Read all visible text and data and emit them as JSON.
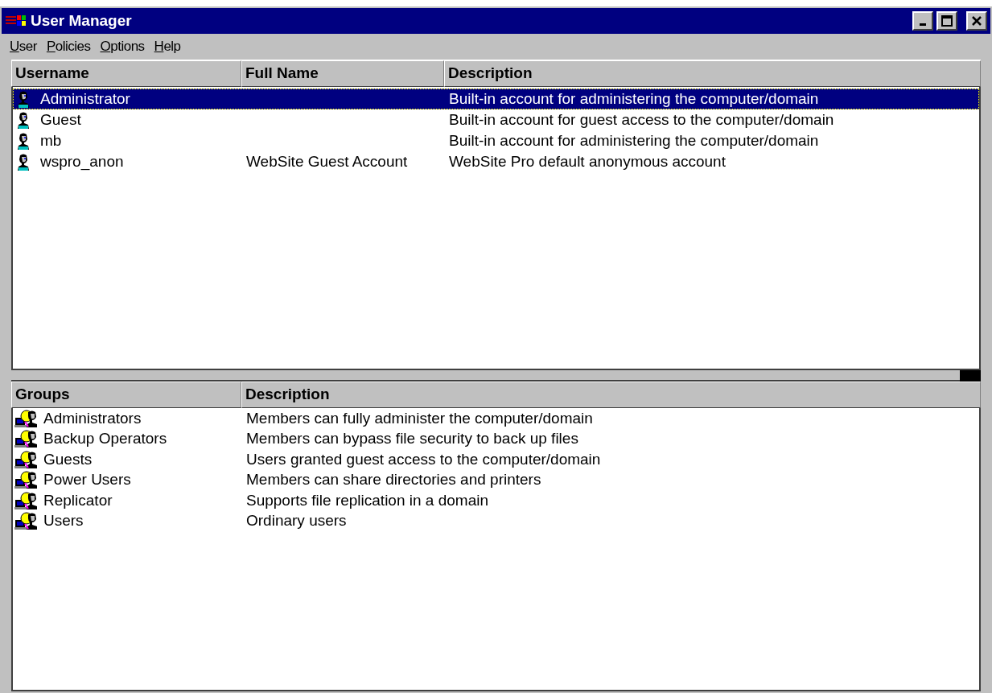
{
  "window": {
    "title": "User Manager"
  },
  "menu": [
    {
      "label": "User"
    },
    {
      "label": "Policies"
    },
    {
      "label": "Options"
    },
    {
      "label": "Help"
    }
  ],
  "users": {
    "columns": [
      "Username",
      "Full Name",
      "Description"
    ],
    "rows": [
      {
        "username": "Administrator",
        "description": "Built-in account for administering the computer/domain",
        "selected": true
      },
      {
        "username": "Guest",
        "description": "Built-in account for guest access to the computer/domain",
        "selected": false
      },
      {
        "username": "mb",
        "description": "Built-in account for administering the computer/domain",
        "selected": false
      },
      {
        "username": "wspro_anon",
        "full_name": "WebSite Guest Account",
        "description": "WebSite Pro default anonymous account",
        "selected": false
      }
    ]
  },
  "groups": {
    "columns": [
      "Groups",
      "Description"
    ],
    "rows": [
      {
        "name": "Administrators",
        "description": "Members can fully administer the computer/domain",
        "selected": false
      },
      {
        "name": "Backup Operators",
        "description": "Members can bypass file security to back up files",
        "selected": false
      },
      {
        "name": "Guests",
        "description": "Users granted guest access to the computer/domain",
        "selected": false
      },
      {
        "name": "Power Users",
        "description": "Members can share directories and printers",
        "selected": false
      },
      {
        "name": "Replicator",
        "description": "Supports file replication in a domain",
        "selected": false
      },
      {
        "name": "Users",
        "description": "Ordinary users",
        "selected": false
      }
    ]
  }
}
